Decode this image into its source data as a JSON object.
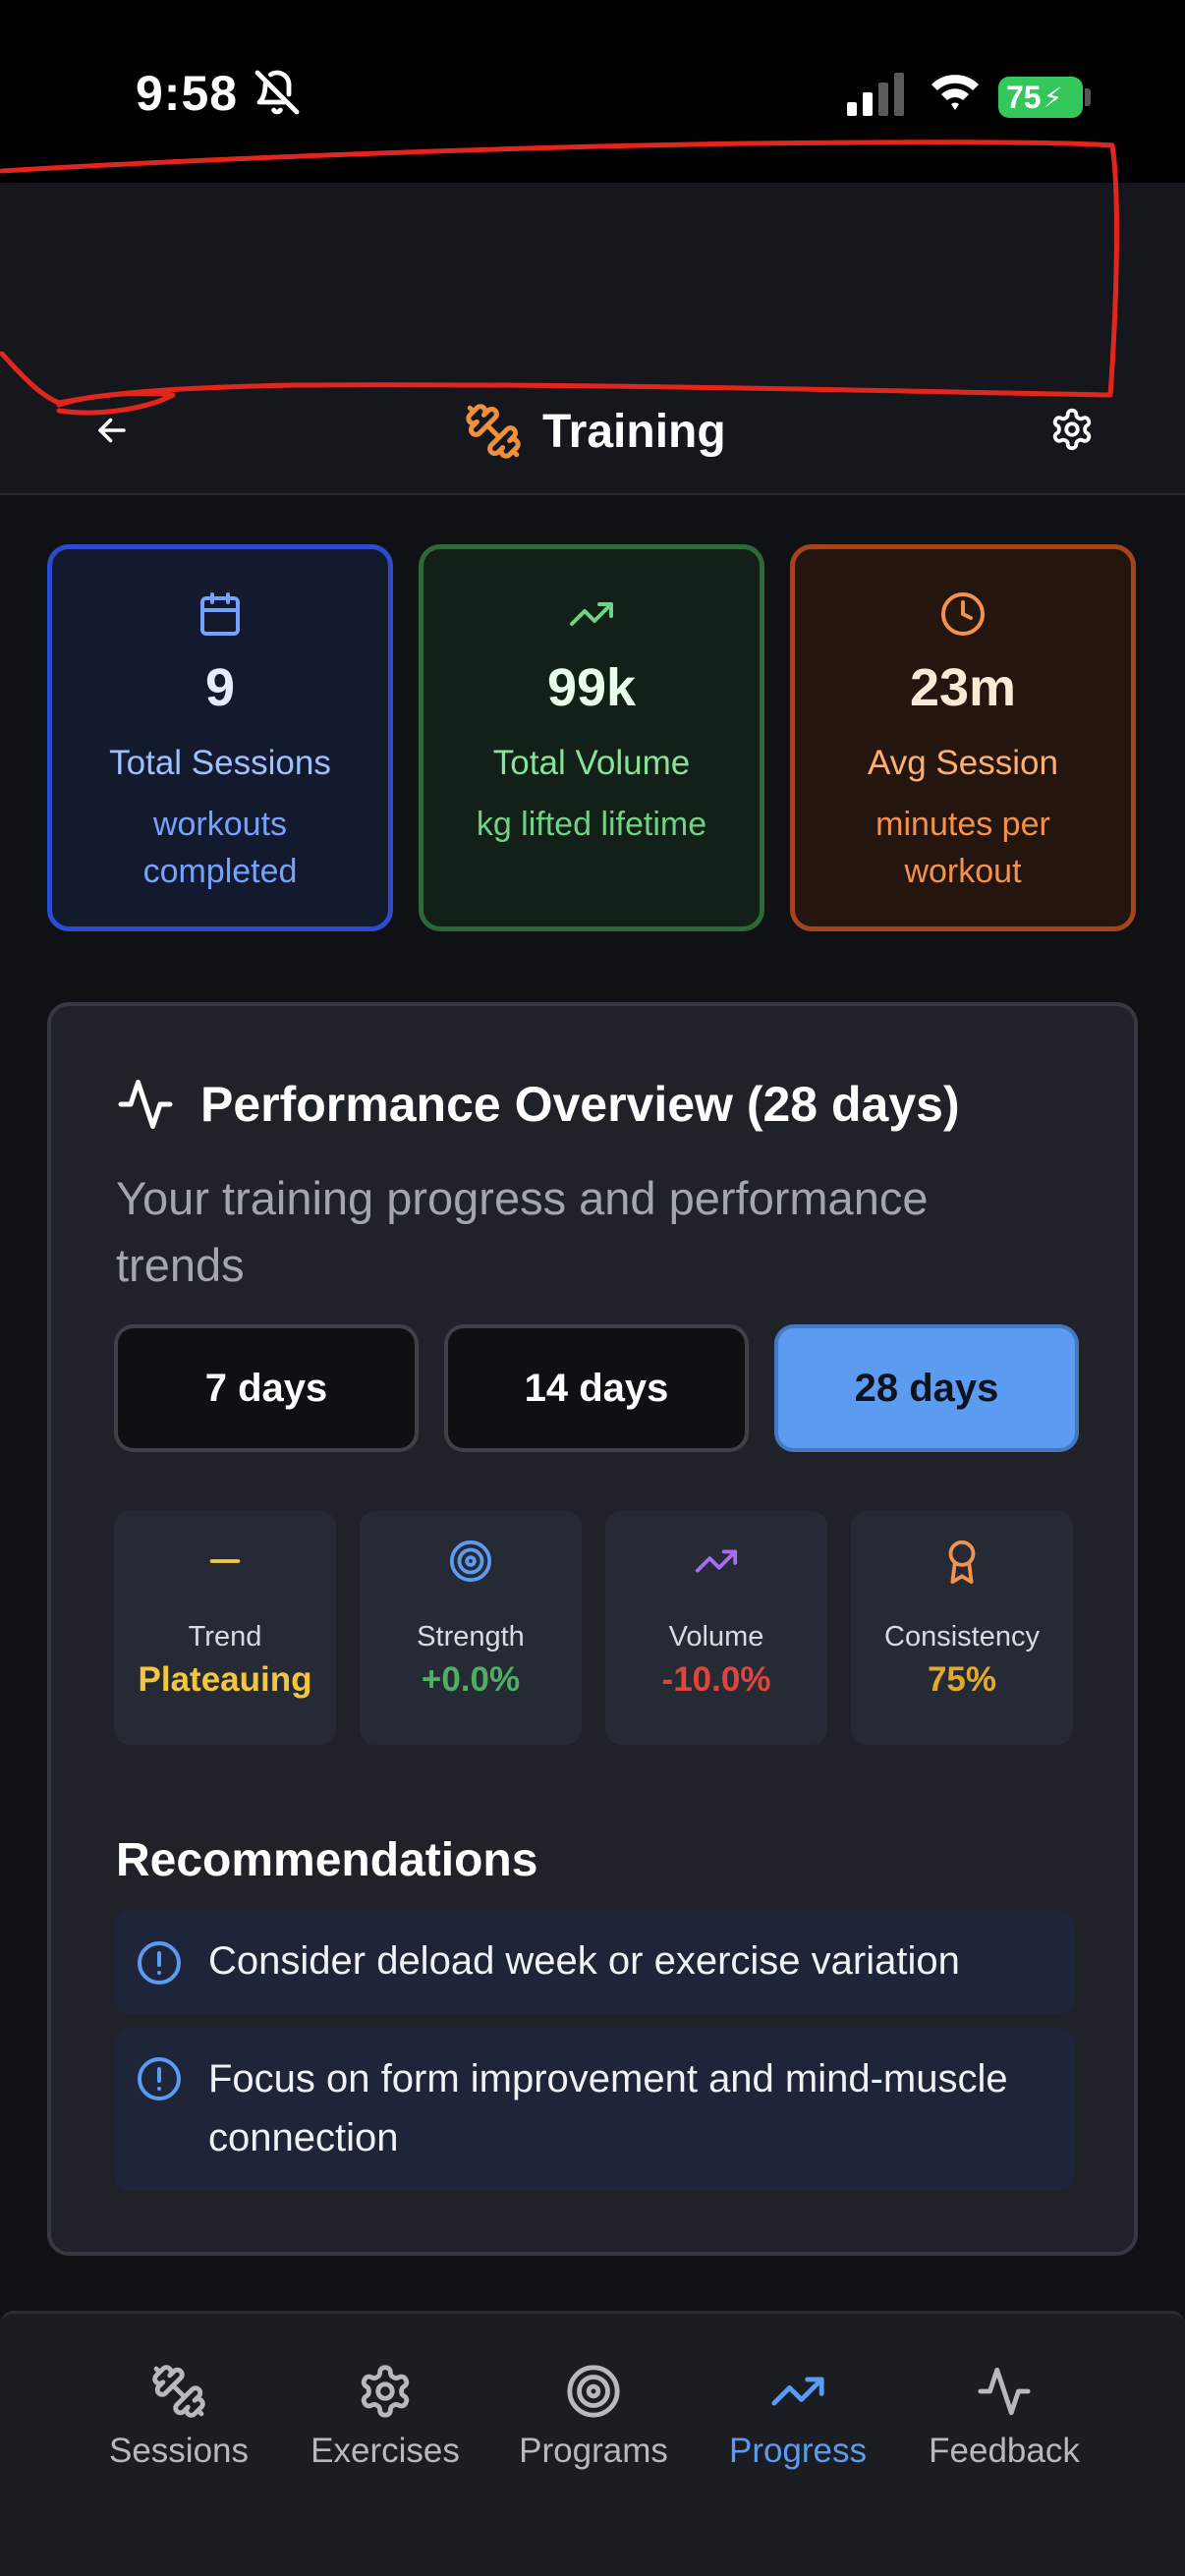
{
  "status_bar": {
    "time": "9:58",
    "battery": "75"
  },
  "header": {
    "title": "Training"
  },
  "stats": [
    {
      "value": "9",
      "label": "Total Sessions",
      "sub": "workouts completed",
      "icon": "calendar-icon",
      "accent": "#2b4bd1"
    },
    {
      "value": "99k",
      "label": "Total Volume",
      "sub": "kg lifted lifetime",
      "icon": "trending-up-icon",
      "accent": "#2b6a37"
    },
    {
      "value": "23m",
      "label": "Avg Session",
      "sub": "minutes per workout",
      "icon": "clock-icon",
      "accent": "#a3441d"
    }
  ],
  "performance": {
    "title": "Performance Overview (28 days)",
    "subtitle": "Your training progress and performance trends",
    "ranges": [
      "7 days",
      "14 days",
      "28 days"
    ],
    "selected_range": "28 days",
    "metrics": [
      {
        "label": "Trend",
        "value": "Plateauing",
        "color": "#f4c63d",
        "icon": "minus-icon"
      },
      {
        "label": "Strength",
        "value": "+0.0%",
        "color": "#4caf61",
        "icon": "target-icon"
      },
      {
        "label": "Volume",
        "value": "-10.0%",
        "color": "#e0453c",
        "icon": "trending-up-icon"
      },
      {
        "label": "Consistency",
        "value": "75%",
        "color": "#e6a82b",
        "icon": "award-icon"
      }
    ],
    "recommendations_heading": "Recommendations",
    "recommendations": [
      "Consider deload week or exercise variation",
      "Focus on form improvement and mind-muscle connection"
    ]
  },
  "tabs": [
    {
      "label": "Sessions",
      "icon": "dumbbell-icon"
    },
    {
      "label": "Exercises",
      "icon": "gear-icon"
    },
    {
      "label": "Programs",
      "icon": "target-icon"
    },
    {
      "label": "Progress",
      "icon": "trending-up-icon",
      "active": true
    },
    {
      "label": "Feedback",
      "icon": "pulse-icon"
    }
  ],
  "colors": {
    "accent": "#5b9bf0",
    "background": "#0f1115",
    "card": "#1f2228"
  }
}
